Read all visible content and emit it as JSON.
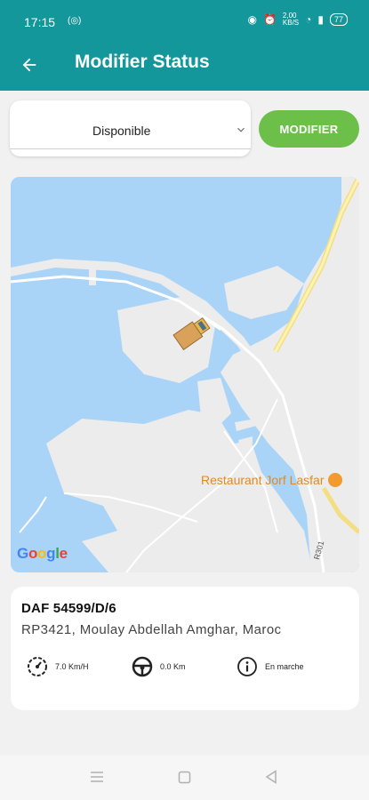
{
  "status_bar": {
    "time": "17:15",
    "right_text": "2,00 KB/S",
    "battery": "77"
  },
  "header": {
    "title": "Modifier Status",
    "back_icon": "arrow-left-icon"
  },
  "status_select": {
    "value": "Disponible"
  },
  "modify_button": {
    "label": "MODIFIER",
    "color": "#6cc04a"
  },
  "map": {
    "poi_label": "Restaurant Jorf Lasfar",
    "road_label": "R301",
    "attribution": "Google"
  },
  "vehicle": {
    "plate": "DAF 54599/D/6",
    "address": "RP3421, Moulay Abdellah Amghar, Maroc",
    "stats": [
      {
        "icon": "speedometer-icon",
        "value": "7.0 Km/H"
      },
      {
        "icon": "steering-wheel-icon",
        "value": "0.0 Km"
      },
      {
        "icon": "info-icon",
        "value": "En marche"
      }
    ]
  },
  "colors": {
    "primary": "#14979b",
    "accent": "#6cc04a"
  }
}
